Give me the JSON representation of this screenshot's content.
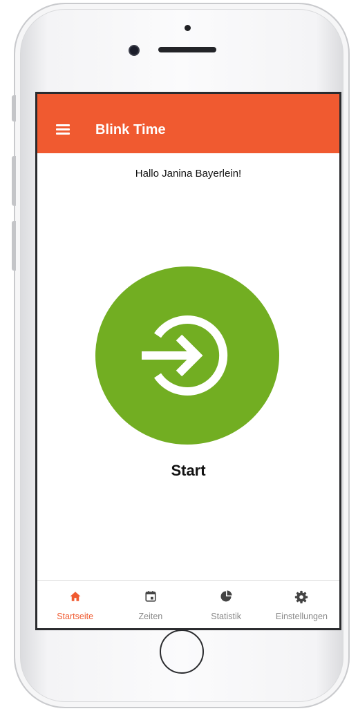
{
  "app": {
    "title": "Blink Time"
  },
  "main": {
    "greeting": "Hallo Janina Bayerlein!",
    "start_label": "Start"
  },
  "tabbar": {
    "items": [
      {
        "label": "Startseite",
        "icon": "home-icon",
        "active": true
      },
      {
        "label": "Zeiten",
        "icon": "calendar-icon",
        "active": false
      },
      {
        "label": "Statistik",
        "icon": "pie-chart-icon",
        "active": false
      },
      {
        "label": "Einstellungen",
        "icon": "gear-icon",
        "active": false
      }
    ]
  },
  "colors": {
    "accent": "#f05a30",
    "start_green": "#72ae22",
    "inactive_tab": "#888888"
  }
}
